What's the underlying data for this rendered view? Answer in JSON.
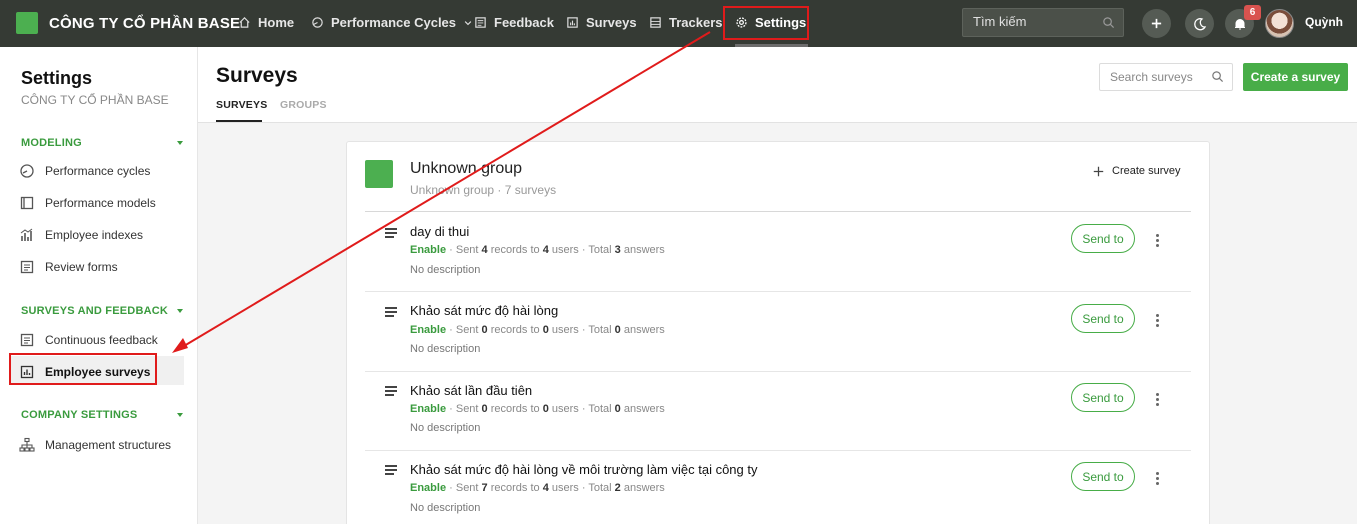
{
  "header": {
    "company": "CÔNG TY CỔ PHẦN BASE",
    "nav": [
      {
        "label": "Home",
        "icon": "home-icon"
      },
      {
        "label": "Performance Cycles",
        "icon": "cycle-icon"
      },
      {
        "label": "Feedback",
        "icon": "feedback-icon"
      },
      {
        "label": "Surveys",
        "icon": "surveys-icon"
      },
      {
        "label": "Trackers",
        "icon": "trackers-icon"
      },
      {
        "label": "Settings",
        "icon": "gear-icon"
      }
    ],
    "search_placeholder": "Tìm kiếm",
    "notification_count": "6",
    "username": "Quỳnh"
  },
  "sidebar": {
    "title": "Settings",
    "subtitle": "CÔNG TY CỔ PHẦN BASE",
    "sections": [
      {
        "label": "MODELING",
        "items": [
          {
            "label": "Performance cycles",
            "icon": "cycle-icon"
          },
          {
            "label": "Performance models",
            "icon": "model-icon"
          },
          {
            "label": "Employee indexes",
            "icon": "indexes-icon"
          },
          {
            "label": "Review forms",
            "icon": "form-icon"
          }
        ]
      },
      {
        "label": "SURVEYS AND FEEDBACK",
        "items": [
          {
            "label": "Continuous feedback",
            "icon": "feedback-icon"
          },
          {
            "label": "Employee surveys",
            "icon": "chart-icon",
            "active": true
          }
        ]
      },
      {
        "label": "COMPANY SETTINGS",
        "items": [
          {
            "label": "Management structures",
            "icon": "hierarchy-icon"
          }
        ]
      }
    ]
  },
  "main": {
    "title": "Surveys",
    "tabs": [
      "SURVEYS",
      "GROUPS"
    ],
    "search_placeholder": "Search surveys",
    "create_button": "Create a survey",
    "group": {
      "name": "Unknown group",
      "meta": "Unknown group · 7 surveys",
      "create_link": "Create survey"
    },
    "surveys": [
      {
        "title": "day di thui",
        "status": "Enable",
        "sent": "4",
        "users": "4",
        "answers": "3",
        "description": "No description"
      },
      {
        "title": "Khảo sát mức độ hài lòng",
        "status": "Enable",
        "sent": "0",
        "users": "0",
        "answers": "0",
        "description": "No description"
      },
      {
        "title": "Khảo sát lần đầu tiên",
        "status": "Enable",
        "sent": "0",
        "users": "0",
        "answers": "0",
        "description": "No description"
      },
      {
        "title": "Khảo sát mức độ hài lòng về môi trường làm việc tại công ty",
        "status": "Enable",
        "sent": "7",
        "users": "4",
        "answers": "2",
        "description": "No description"
      }
    ],
    "row_labels": {
      "sent_prefix": " · Sent ",
      "records_to": " records to ",
      "users_total": " users · Total ",
      "answers": " answers",
      "send_button": "Send to"
    }
  },
  "colors": {
    "accent": "#48ad48",
    "topbar": "#353a34",
    "highlight": "#e01b1b"
  }
}
